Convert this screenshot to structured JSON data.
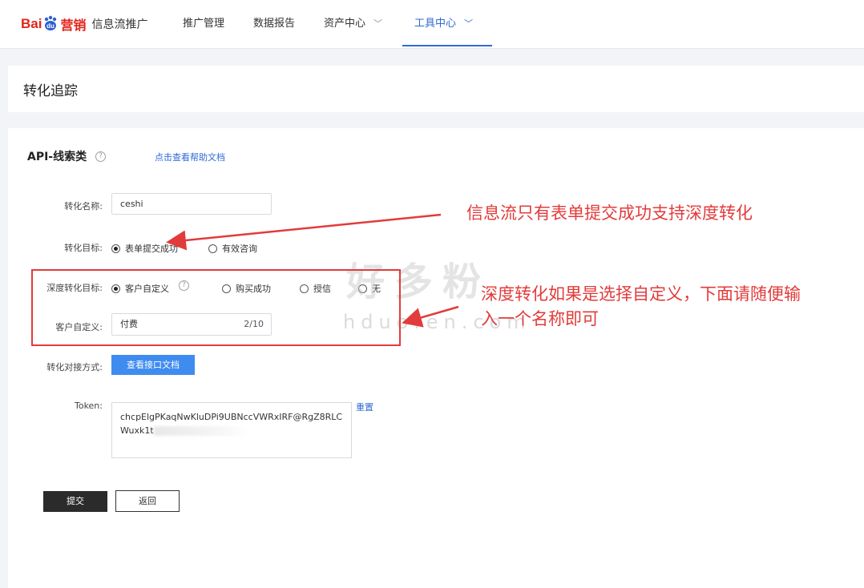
{
  "nav": {
    "brand_bai": "Bai",
    "brand_du": "du",
    "brand_ying": "营销",
    "brand_product": "信息流推广",
    "items": [
      {
        "label": "推广管理"
      },
      {
        "label": "数据报告"
      },
      {
        "label": "资产中心"
      },
      {
        "label": "工具中心"
      }
    ]
  },
  "page": {
    "title": "转化追踪"
  },
  "section": {
    "title": "API-线索类",
    "help_link": "点击查看帮助文档"
  },
  "form": {
    "name_label": "转化名称:",
    "name_value": "ceshi",
    "goal_label": "转化目标:",
    "goal_options": [
      {
        "label": "表单提交成功",
        "selected": true
      },
      {
        "label": "有效咨询",
        "selected": false
      }
    ],
    "deep_label": "深度转化目标:",
    "deep_options": [
      {
        "label": "客户自定义",
        "selected": true
      },
      {
        "label": "购买成功",
        "selected": false
      },
      {
        "label": "授信",
        "selected": false
      },
      {
        "label": "无",
        "selected": false
      }
    ],
    "custom_label": "客户自定义:",
    "custom_value": "付费",
    "custom_counter": "2/10",
    "integration_label": "转化对接方式:",
    "integration_button": "查看接口文档",
    "token_label": "Token:",
    "token_line1": "chcpElgPKaqNwKluDPi9UBNccVWRxIRF@RgZ8RLC",
    "token_line2": "Wuxk1t",
    "reset_link": "重置",
    "submit_button": "提交",
    "back_button": "返回"
  },
  "annotations": {
    "note1": "信息流只有表单提交成功支持深度转化",
    "note2_line1": "深度转化如果是选择自定义，下面请随便输",
    "note2_line2": "入一个名称即可"
  },
  "watermark": {
    "cn": "好多粉",
    "en": "hduofen.com"
  },
  "colors": {
    "brand_red": "#e2231a",
    "link_blue": "#2f6ad6",
    "button_blue": "#3f8cf0",
    "annotation_red": "#e23b3b"
  }
}
